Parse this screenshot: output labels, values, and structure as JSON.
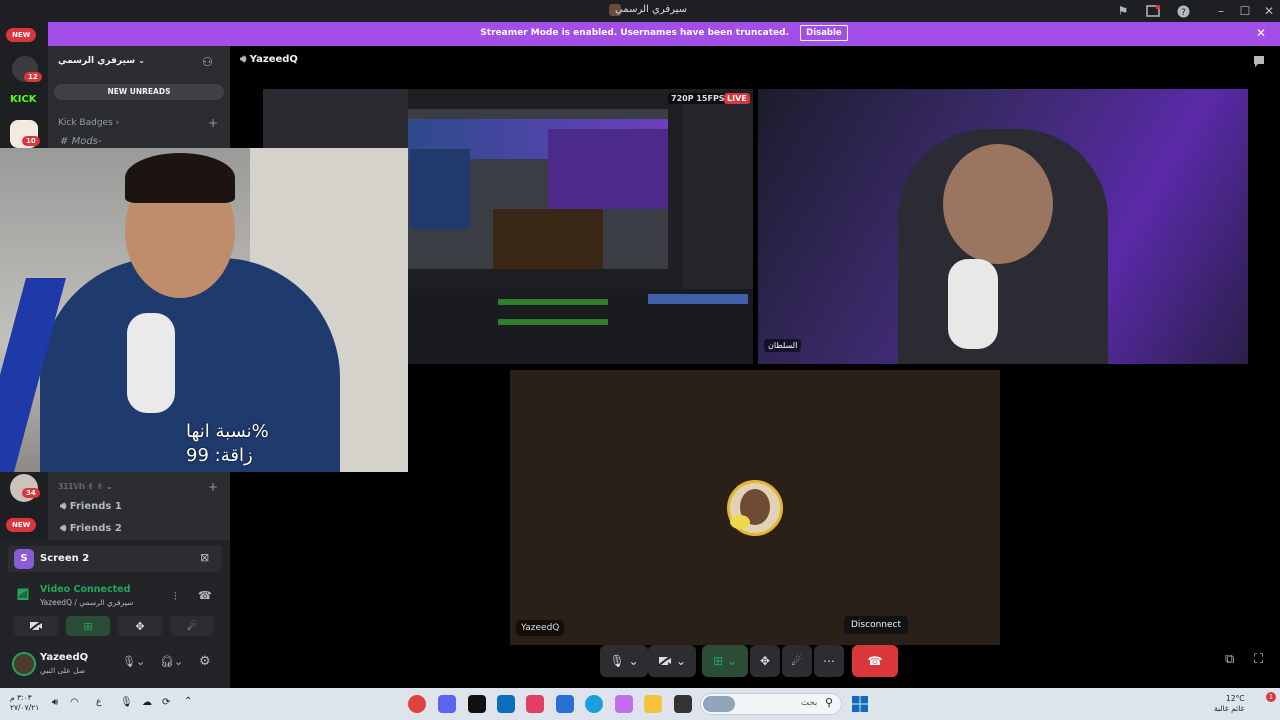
{
  "window": {
    "title": "سيرفري الرسمي",
    "controls": [
      "flag-icon",
      "inbox-icon",
      "help-icon",
      "minimize-icon",
      "maximize-icon",
      "close-icon"
    ]
  },
  "banner": {
    "text": "Streamer Mode is enabled. Usernames have been truncated.",
    "disable_label": "Disable",
    "color": "#a34ee6"
  },
  "server_rail": {
    "new_label_top": "NEW",
    "badge_1": "12",
    "kick_label": "KICK",
    "badge_2": "10",
    "badge_3": "34",
    "new_label_bottom": "NEW"
  },
  "sidebar": {
    "server_name": "سيرفري الرسمي",
    "new_unreads": "NEW UNREADS",
    "category": "Kick Badges",
    "category_channel": "Mods-",
    "voice_category": "𝟛𝟙𝟙𝕍𝕙",
    "voice_channels": [
      "Friends 1",
      "Friends 2"
    ]
  },
  "voice_panel": {
    "screen_share_avatar": "S",
    "screen_share_title": "Screen 2",
    "status": "Video Connected",
    "sub_status": "YazeedQ / سيرفري الرسمي",
    "user_name": "YazeedQ",
    "user_status": "صل على النبي"
  },
  "header": {
    "channel_name": "YazeedQ"
  },
  "tiles": {
    "stream_quality": "720P 15FPS",
    "live_badge": "LIVE",
    "participant_2_label": "السلطان",
    "audio_tile_name": "YazeedQ",
    "overlay_line_1": "نسبة انها%",
    "overlay_line_2": "زاقة:  99"
  },
  "controls": {
    "disconnect_tooltip": "Disconnect",
    "disconnect_color": "#da373c"
  },
  "taskbar": {
    "time": "٣:٠٣ م",
    "date": "٢٧/٠٧/٢١",
    "lang": "ع",
    "search_placeholder": "بحث",
    "weather_temp": "12°C",
    "weather_desc": "غائم غالبة",
    "notif_count": "1"
  }
}
